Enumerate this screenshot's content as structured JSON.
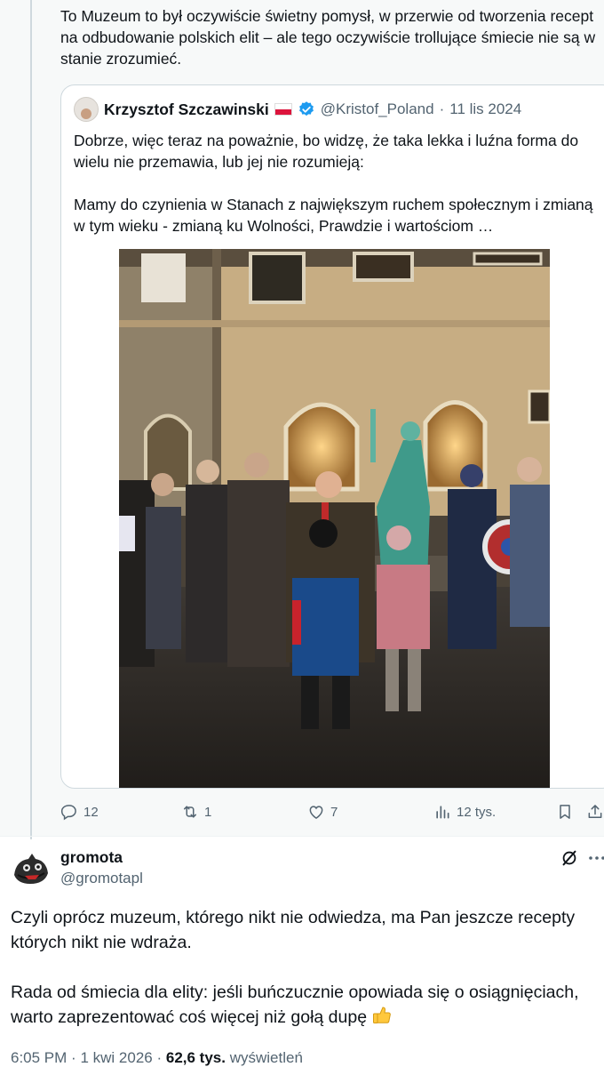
{
  "reply": {
    "text": "To Muzeum to był oczywiście świetny pomysł, w przerwie od tworzenia recept na odbudowanie polskich elit – ale tego oczywiście trollujące śmiecie nie są w stanie zrozumieć."
  },
  "quote": {
    "name": "Krzysztof Szczawinski",
    "handle": "@Kristof_Poland",
    "separator": "·",
    "date": "11 lis 2024",
    "text_p1": "Dobrze, więc teraz na poważnie, bo widzę, że taka lekka i luźna forma do wielu nie przemawia, lub jej nie rozumieją:",
    "text_p2": "Mamy do czynienia w Stanach z największym ruchem społecznym i zmianą w tym wieku - zmianą ku Wolności, Prawdzie i wartościom …"
  },
  "actions": {
    "replies": "12",
    "reposts": "1",
    "likes": "7",
    "views": "12 tys."
  },
  "post": {
    "name": "gromota",
    "handle": "@gromotapl",
    "text_p1": "Czyli oprócz muzeum, którego nikt nie odwiedza, ma Pan jeszcze recepty których nikt nie wdraża.",
    "text_p2": "Rada od śmiecia dla elity: jeśli buńczucznie opowiada się o osiągnięciach, warto zaprezentować coś więcej niż gołą dupę",
    "time": "6:05 PM",
    "date": "1 kwi 2026",
    "views_count": "62,6 tys.",
    "views_label": "wyświetleń",
    "dot": "·"
  },
  "colors": {
    "text": "#0f1419",
    "secondary": "#536471",
    "verified": "#1d9bf0",
    "thread_line": "#cfd9de"
  },
  "icons": [
    "reply-icon",
    "repost-icon",
    "like-icon",
    "views-icon",
    "bookmark-icon",
    "share-icon",
    "grok-icon",
    "more-icon",
    "verified-icon",
    "poland-flag-icon",
    "thumbs-up-emoji"
  ]
}
